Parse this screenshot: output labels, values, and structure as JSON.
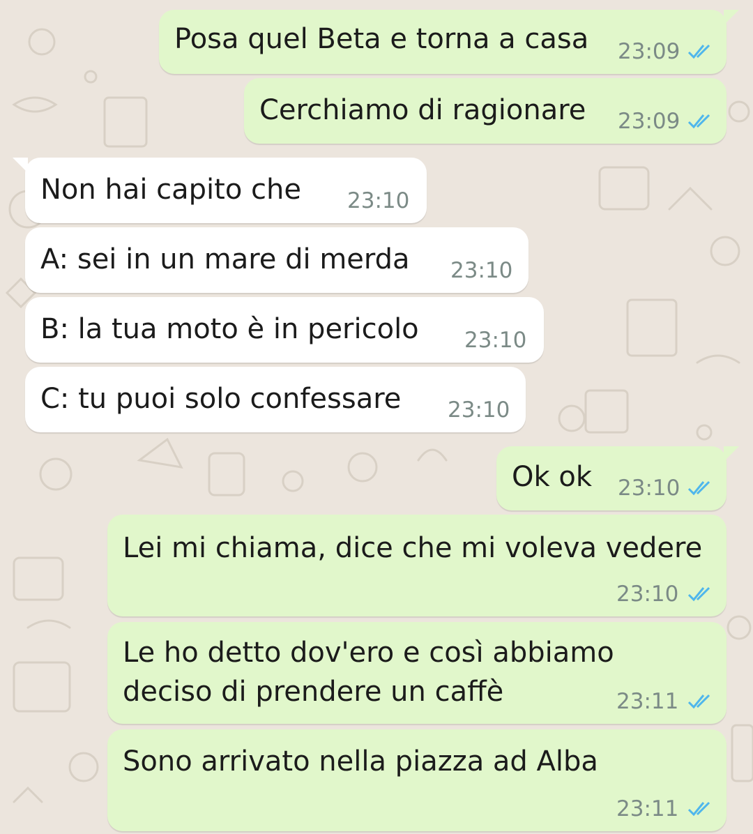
{
  "chat": {
    "messages": [
      {
        "direction": "outgoing",
        "text": "Posa quel Beta e torna a casa",
        "time": "23:09",
        "status": "read"
      },
      {
        "direction": "outgoing",
        "text": "Cerchiamo di ragionare",
        "time": "23:09",
        "status": "read"
      },
      {
        "direction": "incoming",
        "text": "Non hai capito che",
        "time": "23:10"
      },
      {
        "direction": "incoming",
        "text": "A: sei in un mare di merda",
        "time": "23:10"
      },
      {
        "direction": "incoming",
        "text": "B: la tua moto è in pericolo",
        "time": "23:10"
      },
      {
        "direction": "incoming",
        "text": "C: tu puoi solo confessare",
        "time": "23:10"
      },
      {
        "direction": "outgoing",
        "text": "Ok ok",
        "time": "23:10",
        "status": "read"
      },
      {
        "direction": "outgoing",
        "text": "Lei mi chiama, dice che mi voleva vedere",
        "time": "23:10",
        "status": "read"
      },
      {
        "direction": "outgoing",
        "text_lines": [
          "Le ho detto dov'ero e così abbiamo",
          "deciso di prendere un caffè"
        ],
        "time": "23:11",
        "status": "read"
      },
      {
        "direction": "outgoing",
        "text": "Sono arrivato nella piazza ad Alba",
        "time": "23:11",
        "status": "read"
      }
    ]
  },
  "colors": {
    "outgoing_bubble": "#e1f7cb",
    "incoming_bubble": "#ffffff",
    "background": "#ece5dd",
    "read_ticks": "#4fb6ec",
    "timestamp": "#7b8a86"
  },
  "icons": {
    "read_receipt": "double-check-icon"
  }
}
